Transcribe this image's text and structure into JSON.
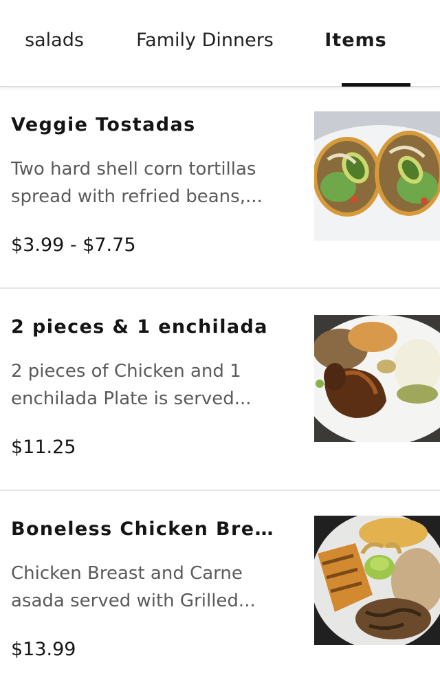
{
  "tabs": [
    {
      "label": "salads",
      "active": false
    },
    {
      "label": "Family Dinners",
      "active": false
    },
    {
      "label": "Items",
      "active": true
    }
  ],
  "items": [
    {
      "name": "Veggie Tostadas",
      "description": "Two hard shell corn tortillas spread with refried beans,...",
      "price": "$3.99 - $7.75",
      "photo_icon": "tostadas-photo"
    },
    {
      "name": "2 pieces & 1 enchilada",
      "description": "2 pieces of Chicken and 1 enchilada Plate is served...",
      "price": "$11.25",
      "photo_icon": "chicken-enchilada-photo"
    },
    {
      "name": "Boneless Chicken Brea...",
      "description": "Chicken Breast and Carne asada served with Grilled...",
      "price": "$13.99",
      "photo_icon": "chicken-carne-asada-photo"
    }
  ],
  "colors": {
    "active_tab_indicator": "#111111",
    "text_primary": "#141414",
    "text_secondary": "#5a5a5a",
    "divider": "#e6e6e6"
  }
}
